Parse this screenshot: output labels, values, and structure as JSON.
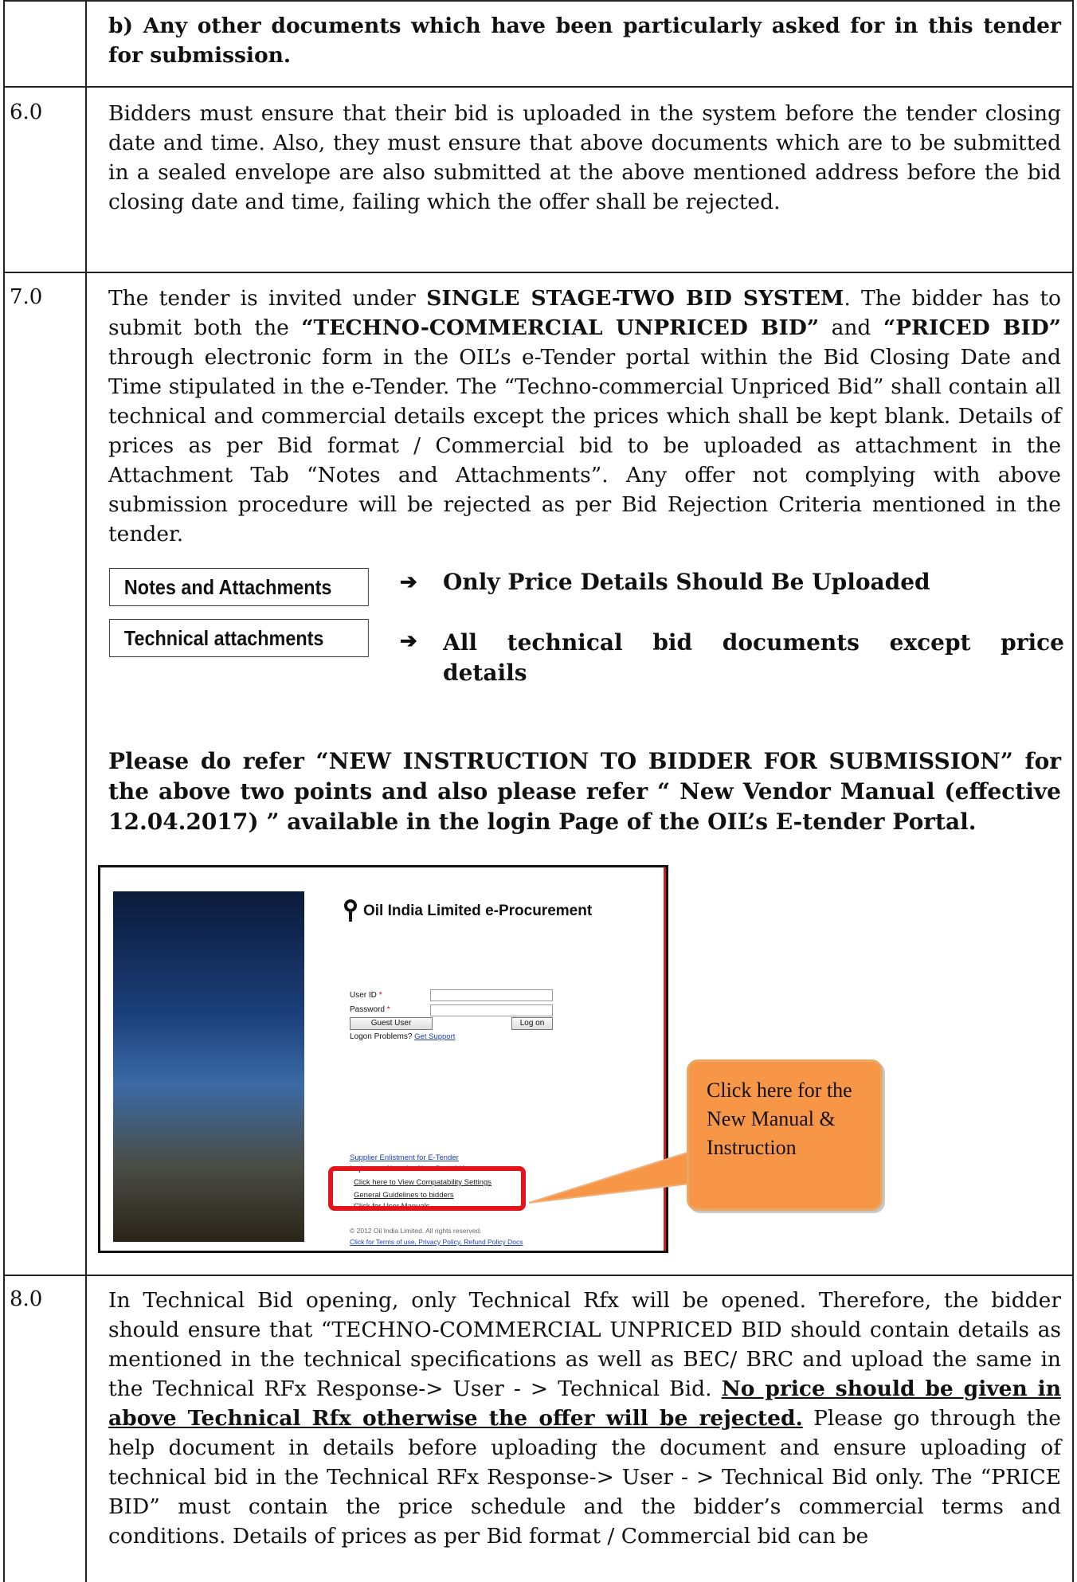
{
  "row_b": {
    "number": "",
    "text": "b) Any other documents which have been particularly asked for in this tender for submission."
  },
  "row_6": {
    "number": "6.0",
    "text": "Bidders must ensure that their bid is uploaded in the system before the tender closing date and time. Also, they must ensure that above documents which are to be submitted in a sealed envelope are also submitted at the above mentioned address before the bid closing date and time, failing which the offer shall be rejected."
  },
  "row_7": {
    "number": "7.0",
    "intro_a": "The tender is invited under ",
    "intro_bold1": "SINGLE STAGE-TWO BID SYSTEM",
    "intro_b": ". The bidder has to submit both the ",
    "intro_bold2": "“TECHNO-COMMERCIAL UNPRICED BID”",
    "intro_c": " and ",
    "intro_bold3": "“PRICED BID”",
    "intro_d": " through electronic form in the OIL’s e-Tender portal within the Bid Closing Date and Time stipulated in the e-Tender. The “Techno-commercial Unpriced Bid” shall contain all technical and commercial details except the prices which shall be kept blank. Details of prices as per Bid format / Commercial bid to be uploaded as attachment in the Attachment Tab “Notes and Attachments”. Any offer not complying with above submission procedure will be rejected as per Bid Rejection Criteria mentioned in the tender.",
    "tab1_label": "Notes and Attachments",
    "tab1_note": "Only Price Details Should Be Uploaded",
    "tab2_label": "Technical attachments",
    "tab2_note": "All technical bid documents except price details",
    "arrow": "➔",
    "refer_text": "Please do refer “NEW INSTRUCTION TO BIDDER FOR SUBMISSION” for the above two points and also please refer “ New Vendor Manual (effective 12.04.2017) ” available in the login Page of the OIL’s E-tender Portal.",
    "screenshot": {
      "logo_text": "Oil India Limited e-Procurement",
      "user_id_label": "User ID",
      "password_label": "Password",
      "required_mark": "*",
      "guest_button": "Guest User",
      "logon_button": "Log on",
      "logon_problems": "Logon Problems?",
      "get_support": "Get Support",
      "supplier_link": "Supplier Enlistment for E-Tender",
      "important_note": "Important Note for New Portal Users:",
      "compat_link": "Click here to View Compatability Settings",
      "guidelines_link": "General Guidelines to bidders",
      "manuals_link": "Click for User Manuals",
      "copyright": "© 2012 Oil India Limited. All rights reserved.",
      "terms_link": "Click for Terms of use, Privacy Policy, Refund Policy Docs"
    },
    "callout_text": "Click here for the New Manual & Instruction"
  },
  "row_8": {
    "number": "8.0",
    "text_a": "In Technical Bid opening, only Technical Rfx will be opened. Therefore, the bidder should ensure that “TECHNO-COMMERCIAL UNPRICED BID should contain details as mentioned in the technical specifications as well as BEC/ BRC and upload the same in the Technical RFx Response-> User - > Technical Bid. ",
    "text_bold": "No price should be given in above Technical Rfx otherwise the offer will be rejected.",
    "text_b": " Please go through the help document in details before uploading the document and ensure uploading of technical bid in the Technical RFx Response-> User - > Technical Bid only. The “PRICE BID” must contain the price schedule and the bidder’s commercial terms and conditions. Details of prices as per Bid format / Commercial bid can be"
  }
}
